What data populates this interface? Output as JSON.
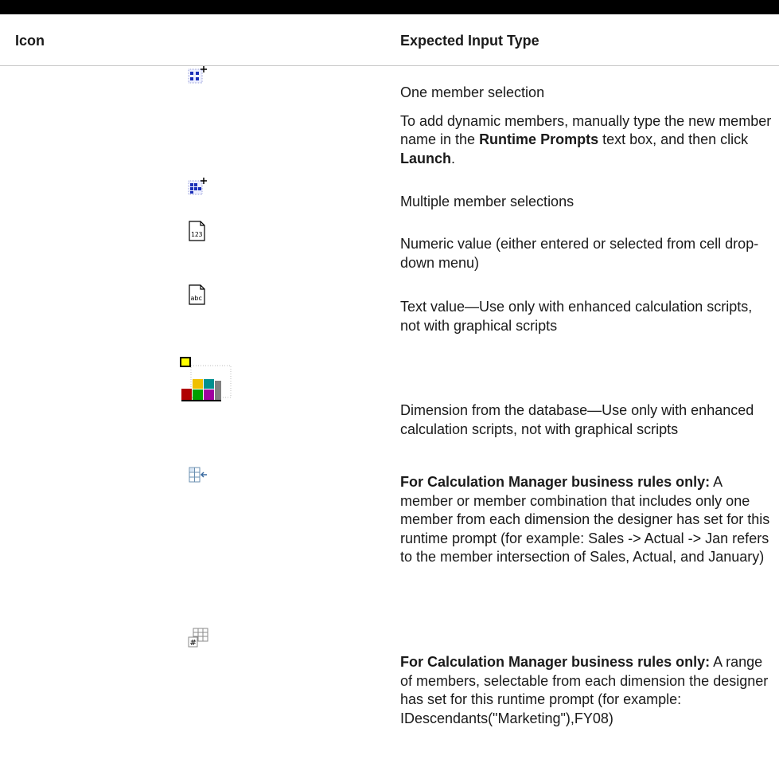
{
  "header": {
    "icon_col": "Icon",
    "type_col": "Expected Input Type"
  },
  "rows": [
    {
      "icon": "one-member-selection-icon",
      "text": "One member selection",
      "extra_prefix": "To add dynamic members, manually type the new member name in the ",
      "extra_bold1": "Runtime Prompts",
      "extra_mid": " text box, and then click ",
      "extra_bold2": "Launch",
      "extra_end": "."
    },
    {
      "icon": "multiple-member-selection-icon",
      "text": "Multiple member selections"
    },
    {
      "icon": "numeric-value-icon",
      "text": "Numeric value (either entered or selected from cell drop-down menu)"
    },
    {
      "icon": "text-value-icon",
      "text": "Text value—Use only with enhanced calculation scripts, not with graphical scripts"
    },
    {
      "icon": "dimension-icon",
      "text": "Dimension from the database—Use only with enhanced calculation scripts, not with graphical scripts"
    },
    {
      "icon": "cross-dimension-icon",
      "bold": "For Calculation Manager business rules only:",
      "text": " A member or member combination that includes only one member from each dimension the designer has set for this runtime prompt (for example: Sales -> Actual -> Jan refers to the member intersection of Sales, Actual, and January)"
    },
    {
      "icon": "member-range-icon",
      "bold": "For Calculation Manager business rules only:",
      "text": " A range of members, selectable from each dimension the designer has set for this runtime prompt (for example: IDescendants(\"Marketing\"),FY08)"
    }
  ]
}
